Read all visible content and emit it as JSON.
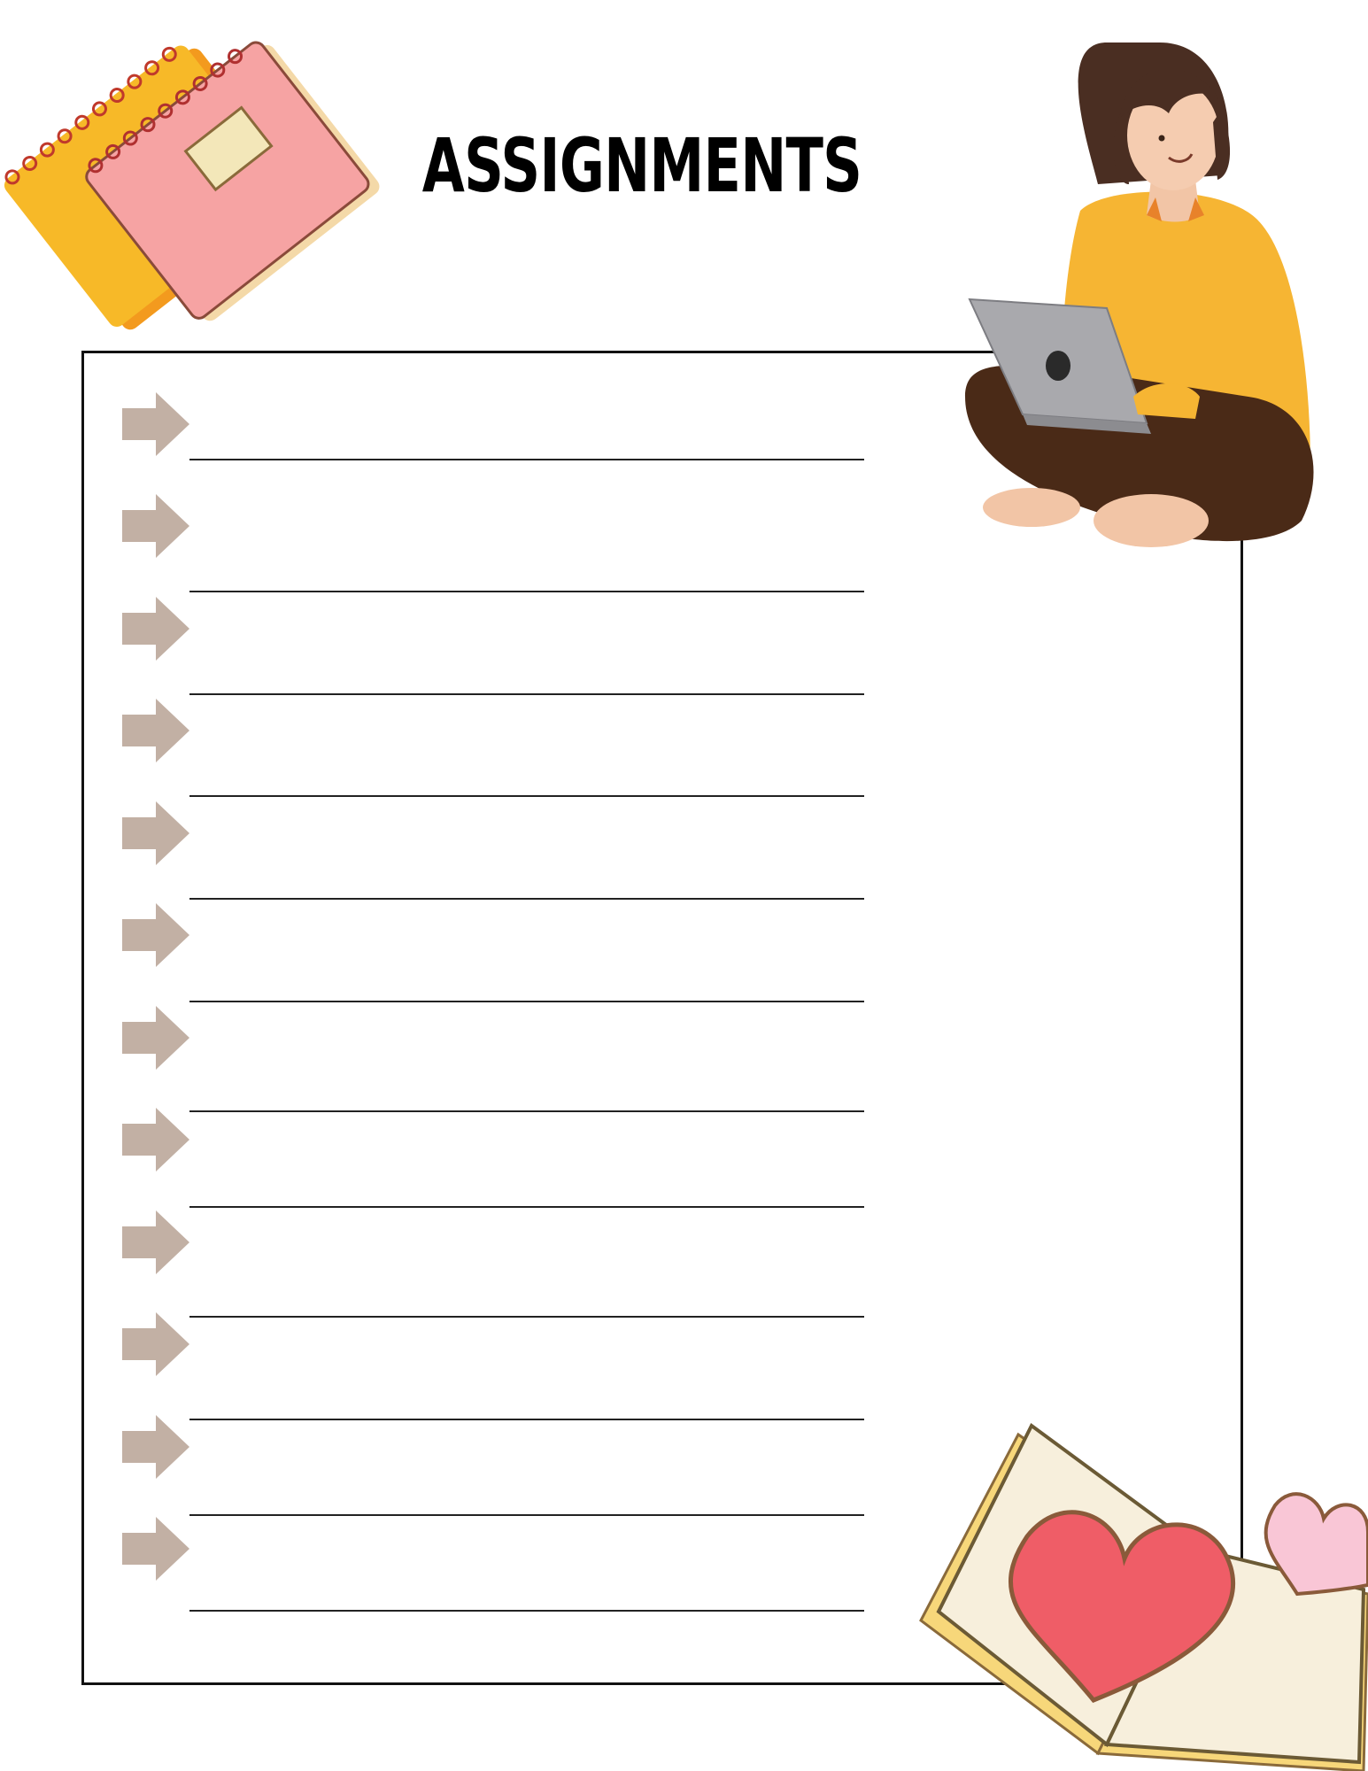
{
  "page": {
    "title": "ASSIGNMENTS"
  },
  "colors": {
    "arrow": "#c2b0a4",
    "frame": "#111111",
    "rule": "#222222"
  },
  "rows": [
    {
      "arrow_icon": "arrow-right-icon"
    },
    {
      "arrow_icon": "arrow-right-icon"
    },
    {
      "arrow_icon": "arrow-right-icon"
    },
    {
      "arrow_icon": "arrow-right-icon"
    },
    {
      "arrow_icon": "arrow-right-icon"
    },
    {
      "arrow_icon": "arrow-right-icon"
    },
    {
      "arrow_icon": "arrow-right-icon"
    },
    {
      "arrow_icon": "arrow-right-icon"
    },
    {
      "arrow_icon": "arrow-right-icon"
    },
    {
      "arrow_icon": "arrow-right-icon"
    },
    {
      "arrow_icon": "arrow-right-icon"
    },
    {
      "arrow_icon": "arrow-right-icon"
    }
  ],
  "decorations": {
    "top_left": "notebooks-illustration",
    "top_right": "girl-with-laptop-illustration",
    "bottom_right": "open-book-hearts-illustration"
  }
}
